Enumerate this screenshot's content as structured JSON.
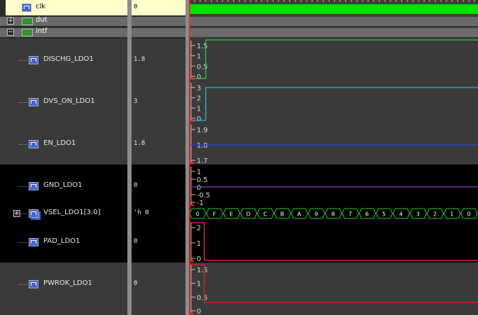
{
  "signals": [
    {
      "name": "clk",
      "value": "0",
      "kind": "signal",
      "expandable": false
    },
    {
      "name": "dut",
      "value": "",
      "kind": "group",
      "expandable": true,
      "expanded": false
    },
    {
      "name": "intf",
      "value": "",
      "kind": "group",
      "expandable": true,
      "expanded": true
    },
    {
      "name": "DISCHG_LDO1",
      "value": "1.8",
      "kind": "analog",
      "expandable": false
    },
    {
      "name": "DVS_ON_LDO1",
      "value": "3",
      "kind": "analog",
      "expandable": false
    },
    {
      "name": "EN_LDO1",
      "value": "1.8",
      "kind": "analog",
      "expandable": false
    },
    {
      "name": "GND_LDO1",
      "value": "0",
      "kind": "analog",
      "expandable": false
    },
    {
      "name": "VSEL_LDO1[3:0]",
      "value": "'h 0",
      "kind": "bus",
      "expandable": true,
      "expanded": false
    },
    {
      "name": "PAD_LDO1",
      "value": "0",
      "kind": "analog",
      "expandable": false
    },
    {
      "name": "PWROK_LDO1",
      "value": "0",
      "kind": "analog",
      "expandable": false
    }
  ],
  "waveforms": {
    "clk": {
      "color": "#00e000"
    },
    "DISCHG_LDO1": {
      "color": "#2ecc40",
      "ticks": [
        "1.5",
        "1",
        "0.5",
        "0"
      ],
      "final": 1.8
    },
    "DVS_ON_LDO1": {
      "color": "#22bbcc",
      "ticks": [
        "3",
        "2",
        "1",
        "0"
      ],
      "final": 3
    },
    "EN_LDO1": {
      "color": "#2244dd",
      "ticks": [
        "1.9",
        "1.8",
        "1.7"
      ],
      "final": 1.8
    },
    "GND_LDO1": {
      "color": "#8833cc",
      "ticks": [
        "1",
        "0.5",
        "0",
        "-0.5",
        "-1"
      ],
      "final": 0
    },
    "VSEL_LDO1[3:0]": {
      "color": "#22cc22",
      "sequence": [
        "0",
        "F",
        "E",
        "D",
        "C",
        "B",
        "A",
        "9",
        "8",
        "7",
        "6",
        "5",
        "4",
        "3",
        "2",
        "1",
        "0"
      ]
    },
    "PAD_LDO1": {
      "color": "#ee2288",
      "ticks": [
        "2",
        "1",
        "0"
      ],
      "final": 0
    },
    "PWROK_LDO1": {
      "color": "#dd2222",
      "ticks": [
        "1.5",
        "1",
        "0.5",
        "0"
      ],
      "final": 0
    }
  },
  "cursor_color": "#ff2020"
}
